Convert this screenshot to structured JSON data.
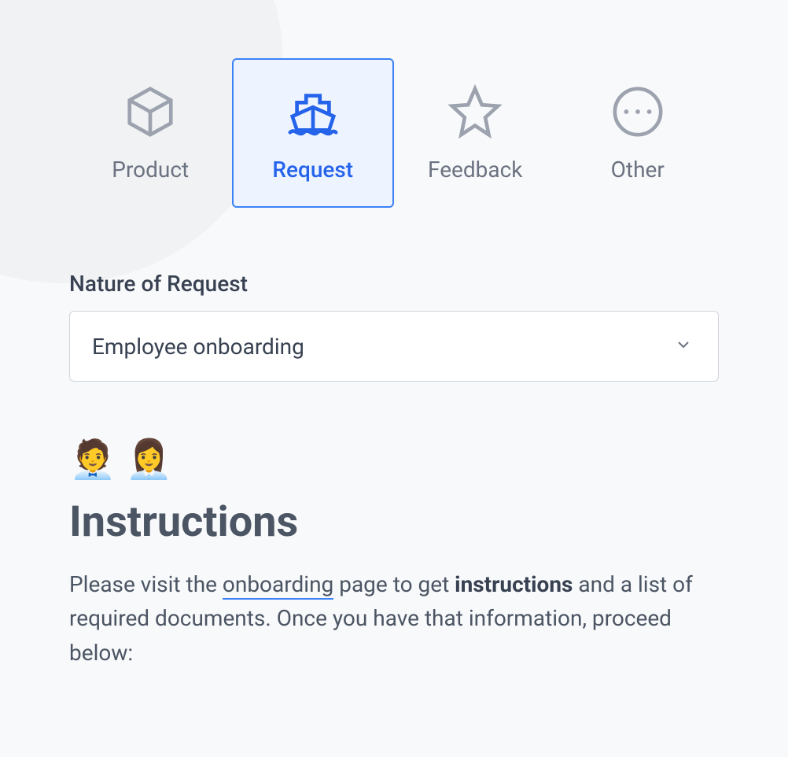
{
  "tabs": [
    {
      "label": "Product",
      "icon": "cube",
      "active": false
    },
    {
      "label": "Request",
      "icon": "ship",
      "active": true
    },
    {
      "label": "Feedback",
      "icon": "star",
      "active": false
    },
    {
      "label": "Other",
      "icon": "more",
      "active": false
    }
  ],
  "form": {
    "nature_label": "Nature of Request",
    "nature_value": "Employee onboarding"
  },
  "instructions": {
    "emoji": "🧑‍💼 👩‍💼",
    "heading": "Instructions",
    "body_prefix": "Please visit the ",
    "body_link": "onboarding",
    "body_mid": " page to get ",
    "body_strong": "instructions",
    "body_suffix": " and a list of required documents. Once you have that information, proceed below:"
  }
}
